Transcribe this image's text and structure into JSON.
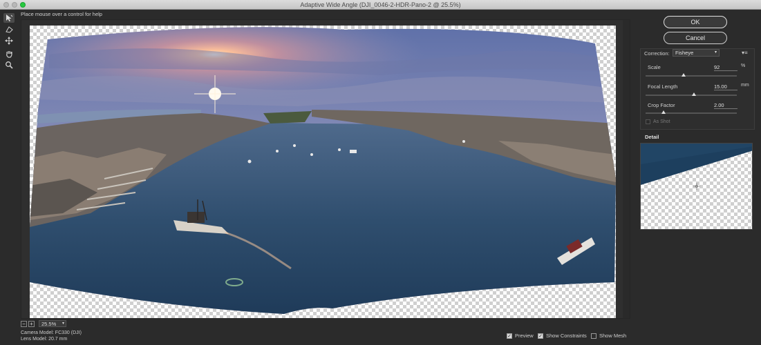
{
  "window": {
    "title": "Adaptive Wide Angle (DJI_0046-2-HDR-Pano-2 @ 25.5%)"
  },
  "help_text": "Place mouse over a control for help",
  "tools": [
    {
      "icon": "constraint-tool-icon"
    },
    {
      "icon": "polygon-constraint-tool-icon"
    },
    {
      "icon": "move-tool-icon"
    },
    {
      "icon": "hand-tool-icon"
    },
    {
      "icon": "zoom-tool-icon"
    }
  ],
  "zoom": {
    "minus": "−",
    "plus": "+",
    "value": "25.5%"
  },
  "lens_info": {
    "camera_model": "Camera Model: FC330 (DJI)",
    "lens_model": "Lens Model: 20.7 mm"
  },
  "bottom_options": {
    "preview_label": "Preview",
    "preview_checked": true,
    "show_constraints_label": "Show Constraints",
    "show_constraints_checked": true,
    "show_mesh_label": "Show Mesh",
    "show_mesh_checked": false
  },
  "buttons": {
    "ok": "OK",
    "cancel": "Cancel"
  },
  "correction": {
    "label": "Correction:",
    "value": "Fisheye"
  },
  "params": {
    "scale": {
      "label": "Scale",
      "value": "92",
      "unit": "%",
      "slider": 0.42
    },
    "focal_length": {
      "label": "Focal Length",
      "value": "15.00",
      "unit": "mm",
      "slider": 0.53
    },
    "crop_factor": {
      "label": "Crop Factor",
      "value": "2.00",
      "unit": "",
      "slider": 0.2
    }
  },
  "as_shot": {
    "label": "As Shot",
    "checked": false
  },
  "detail": {
    "label": "Detail"
  },
  "colors": {
    "sky_top": "#5a6fa8",
    "water": "#2c4b6a",
    "sun": "#ffb38a"
  }
}
